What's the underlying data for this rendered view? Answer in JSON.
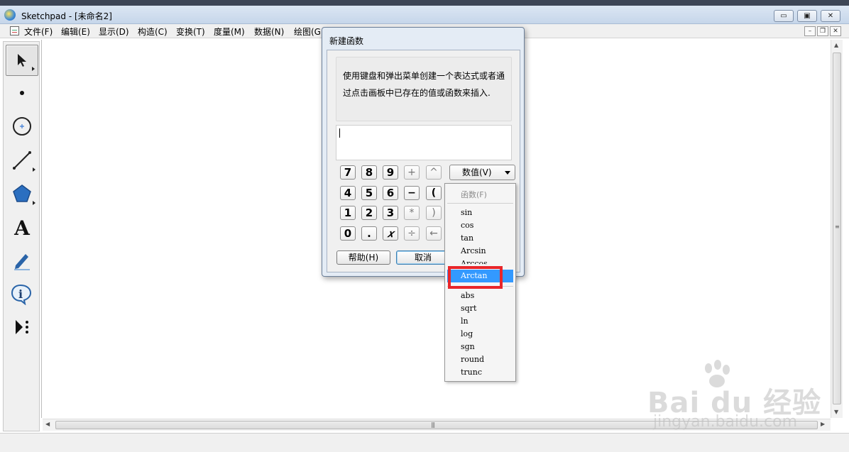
{
  "window": {
    "title": "Sketchpad  - [未命名2]",
    "buttons": {
      "minimize": "▭",
      "restore": "▣",
      "close": "✕"
    }
  },
  "taskbar_strip": [
    "...",
    "...",
    "...",
    "...",
    "...",
    "...",
    "..."
  ],
  "menubar": {
    "items": [
      "文件(F)",
      "编辑(E)",
      "显示(D)",
      "构造(C)",
      "变换(T)",
      "度量(M)",
      "数据(N)",
      "绘图(G"
    ],
    "mdi_buttons": {
      "minimize": "–",
      "restore": "❐",
      "close": "✕"
    }
  },
  "toolbox": {
    "tools": [
      {
        "name": "arrow-tool",
        "icon": "arrow-cursor-icon"
      },
      {
        "name": "point-tool",
        "icon": "dot-icon"
      },
      {
        "name": "compass-tool",
        "icon": "circle-icon"
      },
      {
        "name": "straightedge-tool",
        "icon": "line-segment-icon"
      },
      {
        "name": "polygon-tool",
        "icon": "pentagon-icon"
      },
      {
        "name": "text-tool",
        "icon": "text-A-icon",
        "glyph": "A"
      },
      {
        "name": "marker-tool",
        "icon": "marker-pen-icon"
      },
      {
        "name": "information-tool",
        "icon": "info-icon",
        "glyph": "i"
      },
      {
        "name": "custom-tool",
        "icon": "custom-tool-icon"
      }
    ]
  },
  "dialog": {
    "title": "新建函数",
    "description": "使用键盘和弹出菜单创建一个表达式或者通过点击画板中已存在的值或函数来插入.",
    "expression_value": "",
    "keypad": [
      [
        "7",
        "8",
        "9",
        "+",
        "^"
      ],
      [
        "4",
        "5",
        "6",
        "−",
        "("
      ],
      [
        "1",
        "2",
        "3",
        "*",
        ")"
      ],
      [
        "0",
        ".",
        "𝑥",
        "÷",
        "←"
      ]
    ],
    "value_button": "数值(V)",
    "help_button": "帮助(H)",
    "cancel_button": "取消"
  },
  "function_menu": {
    "header": "函数(F)",
    "items_group1": [
      "sin",
      "cos",
      "tan",
      "Arcsin",
      "Arccos"
    ],
    "highlighted": "Arctan",
    "items_group2": [
      "abs",
      "sqrt",
      "ln",
      "log",
      "sgn",
      "round",
      "trunc"
    ]
  },
  "watermark": {
    "main": "Bai du 经验",
    "sub": "jingyan.baidu.com"
  },
  "colors": {
    "highlight": "#3399ff",
    "annotation_red": "#e8262a",
    "dialog_frame": "#e4ecf5"
  }
}
